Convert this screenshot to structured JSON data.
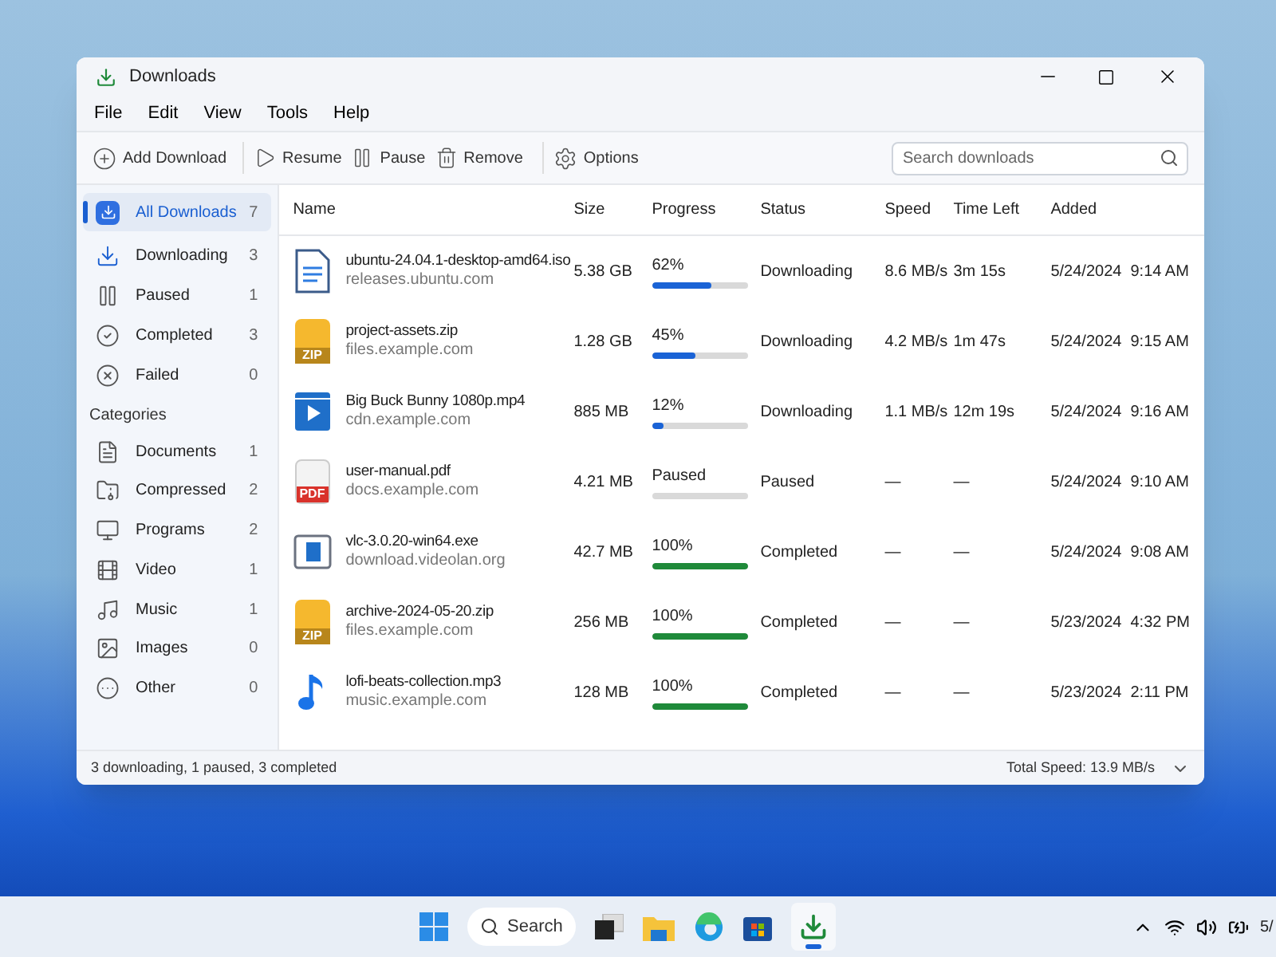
{
  "window": {
    "title": "Downloads"
  },
  "menu": [
    "File",
    "Edit",
    "View",
    "Tools",
    "Help"
  ],
  "toolbar": [
    {
      "kind": "add",
      "label": "Add Download"
    },
    {
      "kind": "resume",
      "label": "Resume"
    },
    {
      "kind": "pause",
      "label": "Pause"
    },
    {
      "kind": "remove",
      "label": "Remove"
    },
    {
      "kind": "options",
      "label": "Options"
    }
  ],
  "search": {
    "placeholder": "Search downloads"
  },
  "sidebar": {
    "items": [
      {
        "kind": "all",
        "label": "All Downloads",
        "count": "7",
        "selected": true
      },
      {
        "kind": "downloading",
        "label": "Downloading",
        "count": "3",
        "selected": false
      },
      {
        "kind": "paused",
        "label": "Paused",
        "count": "1",
        "selected": false
      },
      {
        "kind": "completed",
        "label": "Completed",
        "count": "3",
        "selected": false
      },
      {
        "kind": "failed",
        "label": "Failed",
        "count": "0",
        "selected": false
      }
    ],
    "categories_heading": "Categories",
    "categories": [
      {
        "kind": "documents",
        "label": "Documents",
        "count": "1",
        "selected": false
      },
      {
        "kind": "compressed",
        "label": "Compressed",
        "count": "2",
        "selected": false
      },
      {
        "kind": "programs",
        "label": "Programs",
        "count": "2",
        "selected": false
      },
      {
        "kind": "video",
        "label": "Video",
        "count": "1",
        "selected": false
      },
      {
        "kind": "music",
        "label": "Music",
        "count": "1",
        "selected": false
      },
      {
        "kind": "images",
        "label": "Images",
        "count": "0",
        "selected": false
      },
      {
        "kind": "other",
        "label": "Other",
        "count": "0",
        "selected": false
      }
    ]
  },
  "table": {
    "columns": [
      "Name",
      "Size",
      "Progress",
      "Status",
      "Speed",
      "Time Left",
      "Added"
    ],
    "rows": [
      {
        "kind": "document",
        "name": "ubuntu-24.04.1-desktop-amd64.iso",
        "source": "releases.ubuntu.com",
        "size": "5.38 GB",
        "progress_label": "62%",
        "level": 0.62,
        "color": "#1a63d6",
        "status": "Downloading",
        "speed": "8.6 MB/s",
        "time_left": "3m 15s",
        "added": "5/24/2024  9:14 AM"
      },
      {
        "kind": "zip",
        "badge": "ZIP",
        "name": "project-assets.zip",
        "source": "files.example.com",
        "size": "1.28 GB",
        "progress_label": "45%",
        "level": 0.45,
        "color": "#1a63d6",
        "status": "Downloading",
        "speed": "4.2 MB/s",
        "time_left": "1m 47s",
        "added": "5/24/2024  9:15 AM"
      },
      {
        "kind": "video",
        "name": "Big Buck Bunny 1080p.mp4",
        "source": "cdn.example.com",
        "size": "885 MB",
        "progress_label": "12%",
        "level": 0.12,
        "color": "#1a63d6",
        "status": "Downloading",
        "speed": "1.1 MB/s",
        "time_left": "12m 19s",
        "added": "5/24/2024  9:16 AM"
      },
      {
        "kind": "pdf",
        "badge": "PDF",
        "name": "user-manual.pdf",
        "source": "docs.example.com",
        "size": "4.21 MB",
        "progress_label": "Paused",
        "status": "Paused",
        "speed": "—",
        "time_left": "—",
        "added": "5/24/2024  9:10 AM"
      },
      {
        "kind": "program",
        "name": "vlc-3.0.20-win64.exe",
        "source": "download.videolan.org",
        "size": "42.7 MB",
        "progress_label": "100%",
        "level": 1,
        "color": "#1f8a3a",
        "status": "Completed",
        "speed": "—",
        "time_left": "—",
        "added": "5/24/2024  9:08 AM"
      },
      {
        "kind": "zip",
        "badge": "ZIP",
        "name": "archive-2024-05-20.zip",
        "source": "files.example.com",
        "size": "256 MB",
        "progress_label": "100%",
        "level": 1,
        "color": "#1f8a3a",
        "status": "Completed",
        "speed": "—",
        "time_left": "—",
        "added": "5/23/2024  4:32 PM"
      },
      {
        "kind": "music",
        "name": "lofi-beats-collection.mp3",
        "source": "music.example.com",
        "size": "128 MB",
        "progress_label": "100%",
        "level": 1,
        "color": "#1f8a3a",
        "status": "Completed",
        "speed": "—",
        "time_left": "—",
        "added": "5/23/2024  2:11 PM"
      }
    ]
  },
  "status_bar": {
    "summary": "3 downloading, 1 paused, 3 completed",
    "total_speed": "Total Speed: 13.9 MB/s"
  },
  "taskbar": {
    "search": "Search",
    "clock": "5/"
  }
}
